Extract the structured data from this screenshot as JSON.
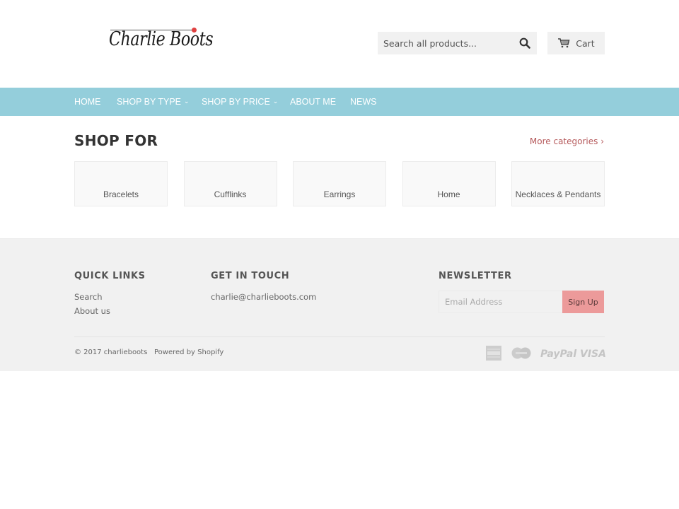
{
  "header": {
    "logo_text": "Charlie Boots",
    "search_placeholder": "Search all products...",
    "search_icon": "magnifier-icon",
    "cart_label": "Cart",
    "cart_icon": "shopping-cart-icon"
  },
  "nav": {
    "items": [
      {
        "label": "HOME",
        "has_dropdown": false
      },
      {
        "label": "SHOP BY TYPE",
        "has_dropdown": true
      },
      {
        "label": "SHOP BY PRICE",
        "has_dropdown": true
      },
      {
        "label": "ABOUT ME",
        "has_dropdown": false
      },
      {
        "label": "NEWS",
        "has_dropdown": false
      }
    ],
    "dropdown_glyph": "⌄",
    "background": "#94cedb"
  },
  "main": {
    "title": "SHOP FOR",
    "more_link": "More categories ›",
    "categories": [
      {
        "label": "Bracelets"
      },
      {
        "label": "Cufflinks"
      },
      {
        "label": "Earrings"
      },
      {
        "label": "Home"
      },
      {
        "label": "Necklaces & Pendants"
      }
    ]
  },
  "footer": {
    "quick_links": {
      "heading": "QUICK LINKS",
      "links": [
        "Search",
        "About us"
      ]
    },
    "get_in_touch": {
      "heading": "GET IN TOUCH",
      "email": "charlie@charlieboots.com"
    },
    "newsletter": {
      "heading": "NEWSLETTER",
      "placeholder": "Email Address",
      "button": "Sign Up",
      "button_color": "#ec9a9a"
    },
    "copyright": "© 2017 charlieboots",
    "powered_by": "Powered by Shopify",
    "payment_icons": [
      "american-express-icon",
      "mastercard-icon",
      "paypal-icon",
      "visa-icon"
    ],
    "paypal_label": "PayPal",
    "visa_label": "VISA"
  },
  "colors": {
    "accent_link": "#b5595b",
    "footer_bg": "#f1f1f1"
  }
}
